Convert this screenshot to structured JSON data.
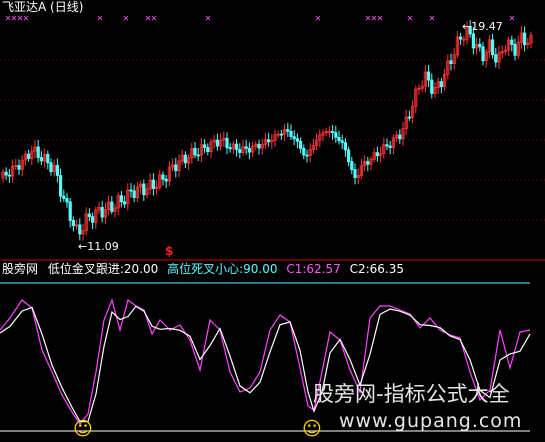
{
  "header": {
    "title": "飞亚达A",
    "period": "(日线)",
    "title_color": "#ffffff"
  },
  "price_panel": {
    "high_label": "19.47",
    "low_label": "11.09",
    "signal_glyph": "$",
    "cross_marker": "✕",
    "up_color": "#ff3333",
    "down_color": "#54ffff",
    "grid_color": "#7a0000"
  },
  "indicator_bar": {
    "name": "股旁网",
    "items": [
      {
        "label": "低位金叉跟进:",
        "value": "20.00",
        "color": "#ffffff"
      },
      {
        "label": "高位死叉小心:",
        "value": "90.00",
        "color": "#54ffff"
      },
      {
        "label": "C1:",
        "value": "62.57",
        "color": "#ff55ff"
      },
      {
        "label": "C2:",
        "value": "66.35",
        "color": "#ffffff"
      }
    ],
    "separator_color": "#cc0000"
  },
  "indicator_panel": {
    "c1_color": "#ff44ff",
    "c2_color": "#ffffff",
    "upper_level_color": "#54ffff",
    "lower_level_color": "#ffffff",
    "smiley_glyph": "☺"
  },
  "watermark": {
    "line1": "股旁网-指标公式大全",
    "line2": "www.gupang.com"
  }
}
